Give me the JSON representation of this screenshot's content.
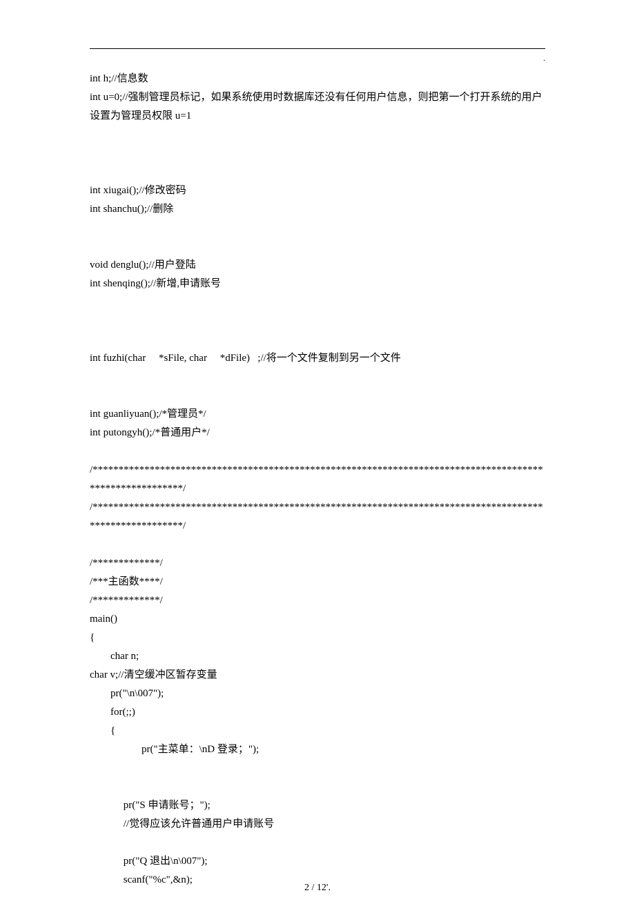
{
  "lines": [
    "int h;//信息数",
    "int u=0;//强制管理员标记，如果系统使用时数据库还没有任何用户信息，则把第一个打开系统的用户设置为管理员权限 u=1",
    "",
    "",
    "",
    "int xiugai();//修改密码",
    "int shanchu();//删除",
    "",
    "",
    "void denglu();//用户登陆",
    "int shenqing();//新增,申请账号",
    "",
    "",
    "",
    "int fuzhi(char     *sFile, char     *dFile)   ;//将一个文件复制到另一个文件",
    "",
    "",
    "int guanliyuan();/*管理员*/",
    "int putongyh();/*普通用户*/",
    "",
    "/*********************************************************************************************************/",
    "/*********************************************************************************************************/",
    "",
    "/*************/",
    "/***主函数****/",
    "/*************/",
    "main()",
    "{",
    "        char n;",
    "char v;//清空缓冲区暂存变量",
    "        pr(\"\\n\\007\");",
    "        for(;;)",
    "        {",
    "                    pr(\"主菜单：\\nD 登录；\");",
    "",
    "",
    "             pr(\"S 申请账号；\");",
    "             //觉得应该允许普通用户申请账号",
    "",
    "             pr(\"Q 退出\\n\\007\");",
    "             scanf(\"%c\",&n);"
  ],
  "page_footer": "2  / 12'.",
  "top_dot": "."
}
